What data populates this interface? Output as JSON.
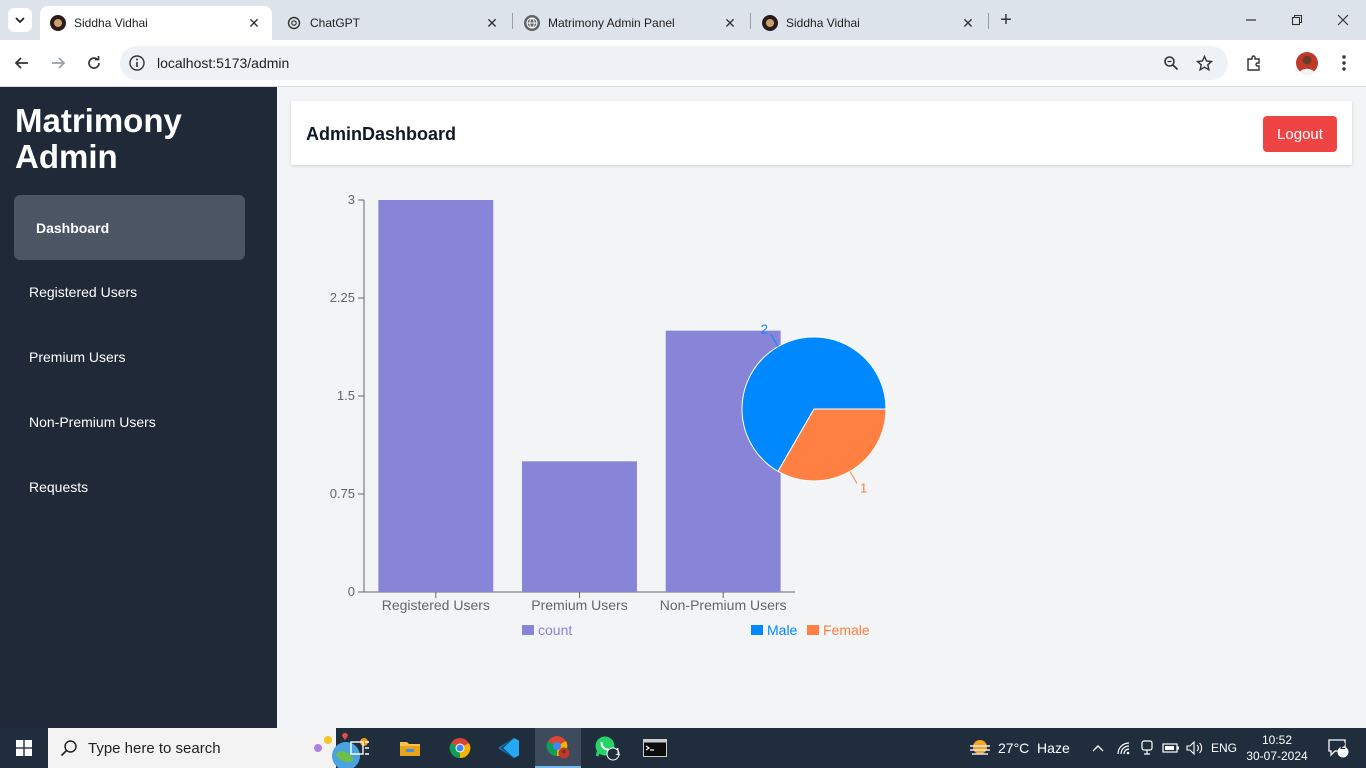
{
  "browser": {
    "tabs": [
      {
        "title": "Siddha Vidhai",
        "active": true,
        "favicon": "siddha-favicon"
      },
      {
        "title": "ChatGPT",
        "active": false,
        "favicon": "openai-favicon"
      },
      {
        "title": "Matrimony Admin Panel",
        "active": false,
        "favicon": "globe-favicon"
      },
      {
        "title": "Siddha Vidhai",
        "active": false,
        "favicon": "siddha-favicon"
      }
    ],
    "url": "localhost:5173/admin"
  },
  "sidebar": {
    "brand": "Matrimony Admin",
    "items": [
      {
        "label": "Dashboard",
        "active": true
      },
      {
        "label": "Registered Users",
        "active": false
      },
      {
        "label": "Premium Users",
        "active": false
      },
      {
        "label": "Non-Premium Users",
        "active": false
      },
      {
        "label": "Requests",
        "active": false
      }
    ]
  },
  "header": {
    "title": "AdminDashboard",
    "logout_label": "Logout"
  },
  "colors": {
    "bar": "#8884d8",
    "male": "#0088FE",
    "female": "#FF8042",
    "logout": "#ef4444",
    "sidebar": "#1f2937"
  },
  "chart_data": [
    {
      "type": "bar",
      "categories": [
        "Registered Users",
        "Premium Users",
        "Non-Premium Users"
      ],
      "series": [
        {
          "name": "count",
          "values": [
            3,
            1,
            2
          ]
        }
      ],
      "yticks": [
        "0",
        "0.75",
        "1.5",
        "2.25",
        "3"
      ],
      "ylim": [
        0,
        3
      ],
      "legend": "bottom"
    },
    {
      "type": "pie",
      "labels": [
        "Male",
        "Female"
      ],
      "values": [
        2,
        1
      ],
      "data_labels": [
        "2",
        "1"
      ],
      "legend": "bottom"
    }
  ],
  "taskbar": {
    "search_placeholder": "Type here to search",
    "weather": "27°C  Haze",
    "language": "ENG",
    "time": "10:52",
    "date": "30-07-2024",
    "notifications": "2",
    "whatsapp_badge": "1"
  }
}
